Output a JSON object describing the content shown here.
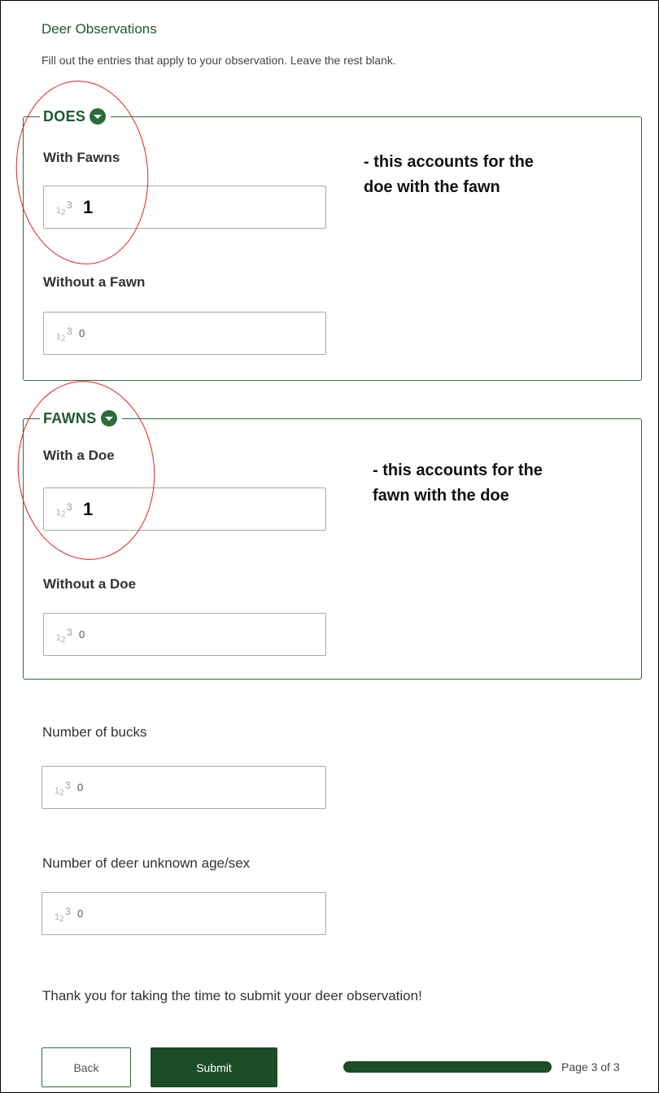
{
  "form": {
    "title": "Deer Observations",
    "description": "Fill out the entries that apply to your observation. Leave the rest blank."
  },
  "groups": {
    "does": {
      "title": "DOES",
      "collapse_icon": "chevron-down-circle-icon",
      "fields": [
        {
          "label": "With Fawns",
          "value": "1"
        },
        {
          "label": "Without a Fawn",
          "value": "0"
        }
      ]
    },
    "fawns": {
      "title": "FAWNS",
      "collapse_icon": "chevron-down-circle-icon",
      "fields": [
        {
          "label": "With a Doe",
          "value": "1"
        },
        {
          "label": "Without a Doe",
          "value": "0"
        }
      ]
    }
  },
  "fields": {
    "bucks": {
      "label": "Number of bucks",
      "value": "0"
    },
    "unknown": {
      "label": "Number of deer unknown age/sex",
      "value": "0"
    }
  },
  "annotations": {
    "does": {
      "line1": "- this accounts for the",
      "line2": "doe with the fawn"
    },
    "fawns": {
      "line1": "- this accounts for the",
      "line2": "fawn with the doe"
    }
  },
  "number_icon": {
    "d1": "1",
    "d2": "2",
    "d3": "3"
  },
  "thanks": "Thank you for taking the time to submit your deer observation!",
  "footer": {
    "back_label": "Back",
    "submit_label": "Submit",
    "progress": 1.0,
    "page_indicator": "Page 3 of 3"
  },
  "colors": {
    "accent": "#1e5a2e",
    "button": "#1b4d26",
    "annotation_circle": "#e02020"
  }
}
